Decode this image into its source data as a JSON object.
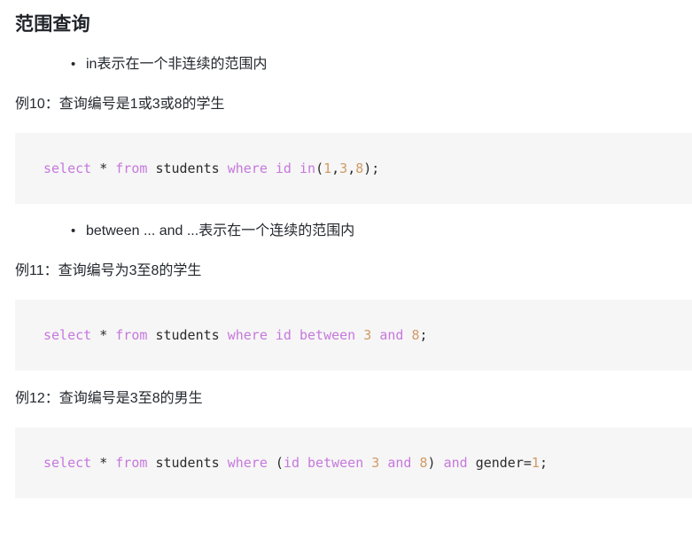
{
  "document": {
    "title": "范围查询"
  },
  "sections": [
    {
      "bullet": "in表示在一个非连续的范围内",
      "example_label": "例10：查询编号是1或3或8的学生",
      "code_tokens": [
        {
          "text": "select",
          "type": "keyword"
        },
        {
          "text": " ",
          "type": "plain"
        },
        {
          "text": "*",
          "type": "plain"
        },
        {
          "text": " ",
          "type": "plain"
        },
        {
          "text": "from",
          "type": "keyword"
        },
        {
          "text": " ",
          "type": "plain"
        },
        {
          "text": "students",
          "type": "plain"
        },
        {
          "text": " ",
          "type": "plain"
        },
        {
          "text": "where",
          "type": "keyword"
        },
        {
          "text": " ",
          "type": "plain"
        },
        {
          "text": "id",
          "type": "keyword"
        },
        {
          "text": " ",
          "type": "plain"
        },
        {
          "text": "in",
          "type": "keyword"
        },
        {
          "text": "(",
          "type": "punct"
        },
        {
          "text": "1",
          "type": "number"
        },
        {
          "text": ",",
          "type": "punct"
        },
        {
          "text": "3",
          "type": "number"
        },
        {
          "text": ",",
          "type": "punct"
        },
        {
          "text": "8",
          "type": "number"
        },
        {
          "text": ");",
          "type": "punct"
        }
      ],
      "code_plain": "select * from students where id in(1,3,8);"
    },
    {
      "bullet": "between ... and ...表示在一个连续的范围内",
      "example_label": "例11：查询编号为3至8的学生",
      "code_tokens": [
        {
          "text": "select",
          "type": "keyword"
        },
        {
          "text": " ",
          "type": "plain"
        },
        {
          "text": "*",
          "type": "plain"
        },
        {
          "text": " ",
          "type": "plain"
        },
        {
          "text": "from",
          "type": "keyword"
        },
        {
          "text": " ",
          "type": "plain"
        },
        {
          "text": "students",
          "type": "plain"
        },
        {
          "text": " ",
          "type": "plain"
        },
        {
          "text": "where",
          "type": "keyword"
        },
        {
          "text": " ",
          "type": "plain"
        },
        {
          "text": "id",
          "type": "keyword"
        },
        {
          "text": " ",
          "type": "plain"
        },
        {
          "text": "between",
          "type": "keyword"
        },
        {
          "text": " ",
          "type": "plain"
        },
        {
          "text": "3",
          "type": "number"
        },
        {
          "text": " ",
          "type": "plain"
        },
        {
          "text": "and",
          "type": "keyword"
        },
        {
          "text": " ",
          "type": "plain"
        },
        {
          "text": "8",
          "type": "number"
        },
        {
          "text": ";",
          "type": "punct"
        }
      ],
      "code_plain": "select * from students where id between 3 and 8;"
    },
    {
      "bullet": null,
      "example_label": "例12：查询编号是3至8的男生",
      "code_tokens": [
        {
          "text": "select",
          "type": "keyword"
        },
        {
          "text": " ",
          "type": "plain"
        },
        {
          "text": "*",
          "type": "plain"
        },
        {
          "text": " ",
          "type": "plain"
        },
        {
          "text": "from",
          "type": "keyword"
        },
        {
          "text": " ",
          "type": "plain"
        },
        {
          "text": "students",
          "type": "plain"
        },
        {
          "text": " ",
          "type": "plain"
        },
        {
          "text": "where",
          "type": "keyword"
        },
        {
          "text": " ",
          "type": "plain"
        },
        {
          "text": "(",
          "type": "punct"
        },
        {
          "text": "id",
          "type": "keyword"
        },
        {
          "text": " ",
          "type": "plain"
        },
        {
          "text": "between",
          "type": "keyword"
        },
        {
          "text": " ",
          "type": "plain"
        },
        {
          "text": "3",
          "type": "number"
        },
        {
          "text": " ",
          "type": "plain"
        },
        {
          "text": "and",
          "type": "keyword"
        },
        {
          "text": " ",
          "type": "plain"
        },
        {
          "text": "8",
          "type": "number"
        },
        {
          "text": ")",
          "type": "punct"
        },
        {
          "text": " ",
          "type": "plain"
        },
        {
          "text": "and",
          "type": "keyword"
        },
        {
          "text": " ",
          "type": "plain"
        },
        {
          "text": "gender",
          "type": "plain"
        },
        {
          "text": "=",
          "type": "punct"
        },
        {
          "text": "1",
          "type": "number"
        },
        {
          "text": ";",
          "type": "punct"
        }
      ],
      "code_plain": "select * from students where (id between 3 and 8) and gender=1;"
    }
  ],
  "colors": {
    "page_background": "#ffffff",
    "code_background": "#f6f6f6",
    "text": "#24292f",
    "heading": "#1f2328",
    "keyword": "#c678dd",
    "number": "#d19a66",
    "plain_code": "#2b2b2b"
  }
}
